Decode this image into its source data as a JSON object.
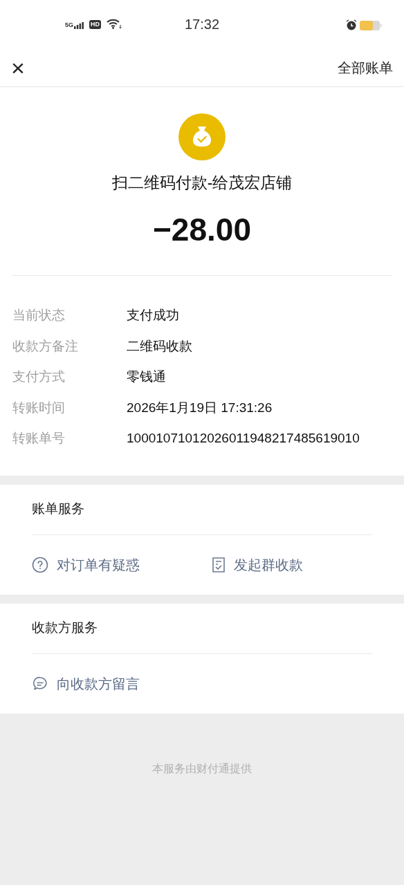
{
  "status_bar": {
    "network": "5G",
    "hd": "HD",
    "time": "17:32"
  },
  "nav": {
    "close": "×",
    "link": "全部账单"
  },
  "payment": {
    "title": "扫二维码付款-给茂宏店铺",
    "amount": "−28.00"
  },
  "details": [
    {
      "label": "当前状态",
      "value": "支付成功"
    },
    {
      "label": "收款方备注",
      "value": "二维码收款"
    },
    {
      "label": "支付方式",
      "value": "零钱通"
    },
    {
      "label": "转账时间",
      "value": "2026年1月19日 17:31:26"
    },
    {
      "label": "转账单号",
      "value": "10001071012026011948217485619010"
    }
  ],
  "sections": [
    {
      "title": "账单服务",
      "actions": [
        {
          "kind": "question",
          "label": "对订单有疑惑"
        },
        {
          "kind": "receipt",
          "label": "发起群收款"
        }
      ]
    },
    {
      "title": "收款方服务",
      "actions": [
        {
          "kind": "message",
          "label": "向收款方留言"
        }
      ]
    }
  ],
  "footer": "本服务由财付通提供"
}
